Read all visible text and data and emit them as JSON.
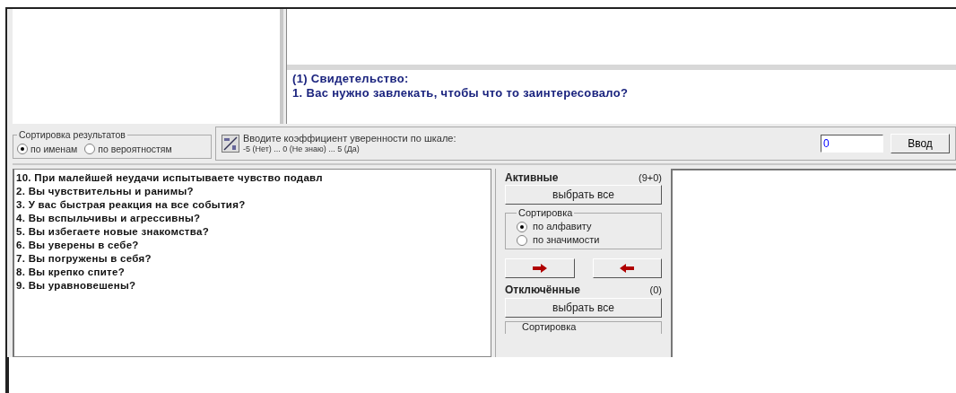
{
  "evidence": {
    "title": "(1) Свидетельство:",
    "question": "1. Вас нужно завлекать, чтобы что то заинтересовало?"
  },
  "result_sort": {
    "legend": "Сортировка результатов",
    "options": [
      {
        "label": "по именам",
        "selected": true
      },
      {
        "label": "по вероятностям",
        "selected": false
      }
    ]
  },
  "input": {
    "prompt": "Вводите коэффициент уверенности по шкале:",
    "scale": "-5 (Нет) ... 0 (Не знаю) ... 5 (Да)",
    "value": "0",
    "button": "Ввод"
  },
  "questions": [
    "10. При малейшей неудачи испытываете чувство подавл",
    "2. Вы чувствительны и ранимы?",
    "3. У вас быстрая реакция на все события?",
    "4. Вы вспыльчивы и агрессивны?",
    "5. Вы избегаете новые знакомства?",
    "6. Вы уверены в себе?",
    "7. Вы погружены в себя?",
    "8. Вы крепко спите?",
    "9. Вы уравновешены?"
  ],
  "active": {
    "title": "Активные",
    "count": "(9+0)",
    "select_all": "выбрать все",
    "sort_legend": "Сортировка",
    "options": [
      {
        "label": "по алфавиту",
        "selected": true
      },
      {
        "label": "по значимости",
        "selected": false
      }
    ]
  },
  "disabled": {
    "title": "Отключённые",
    "count": "(0)",
    "select_all": "выбрать все",
    "sort_legend": "Сортировка"
  }
}
